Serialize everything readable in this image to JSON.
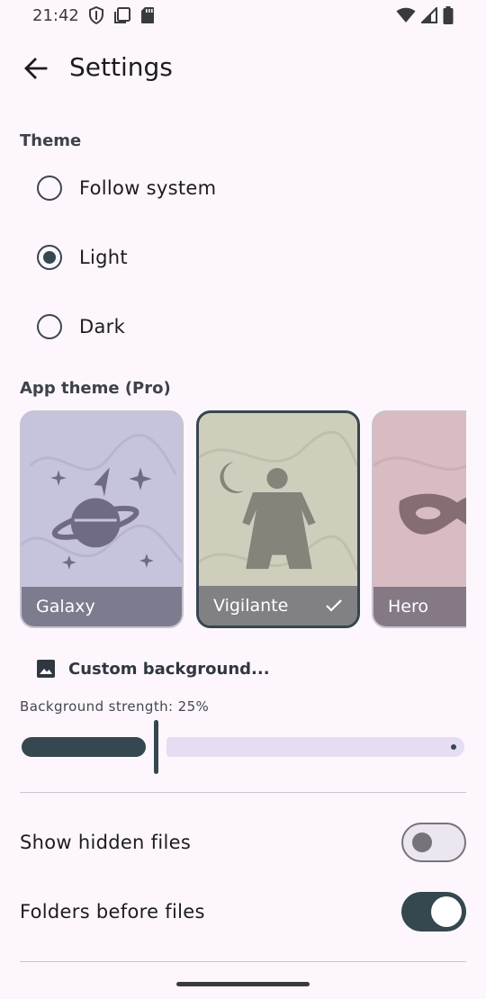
{
  "status_bar": {
    "time": "21:42",
    "left_icons": [
      "shield-icon",
      "screen-copy-icon",
      "sd-card-icon"
    ],
    "right_icons": [
      "wifi-icon",
      "signal-icon",
      "battery-icon"
    ]
  },
  "app_bar": {
    "back_icon": "arrow-back-icon",
    "title": "Settings"
  },
  "theme_section": {
    "label": "Theme",
    "options": [
      {
        "label": "Follow system",
        "selected": false
      },
      {
        "label": "Light",
        "selected": true
      },
      {
        "label": "Dark",
        "selected": false
      }
    ]
  },
  "app_theme_section": {
    "label": "App theme (Pro)",
    "themes": [
      {
        "name": "Galaxy",
        "selected": false,
        "art": "planet-stars-icon",
        "color": "#c6c3dd"
      },
      {
        "name": "Vigilante",
        "selected": true,
        "art": "caped-hero-moon-icon",
        "color": "#cfcdbc",
        "check_icon": "check-icon"
      },
      {
        "name": "Hero",
        "selected": false,
        "art": "mask-icon",
        "color": "#d8bcc2"
      }
    ]
  },
  "custom_background": {
    "icon": "image-icon",
    "label": "Custom background..."
  },
  "background_strength": {
    "label": "Background strength: 25%",
    "value_percent": 25
  },
  "switches": [
    {
      "label": "Show hidden files",
      "on": false
    },
    {
      "label": "Folders before files",
      "on": true
    }
  ],
  "colors": {
    "background": "#fdf7fd",
    "accent": "#35474f",
    "slider_track": "#e6ddf2"
  }
}
